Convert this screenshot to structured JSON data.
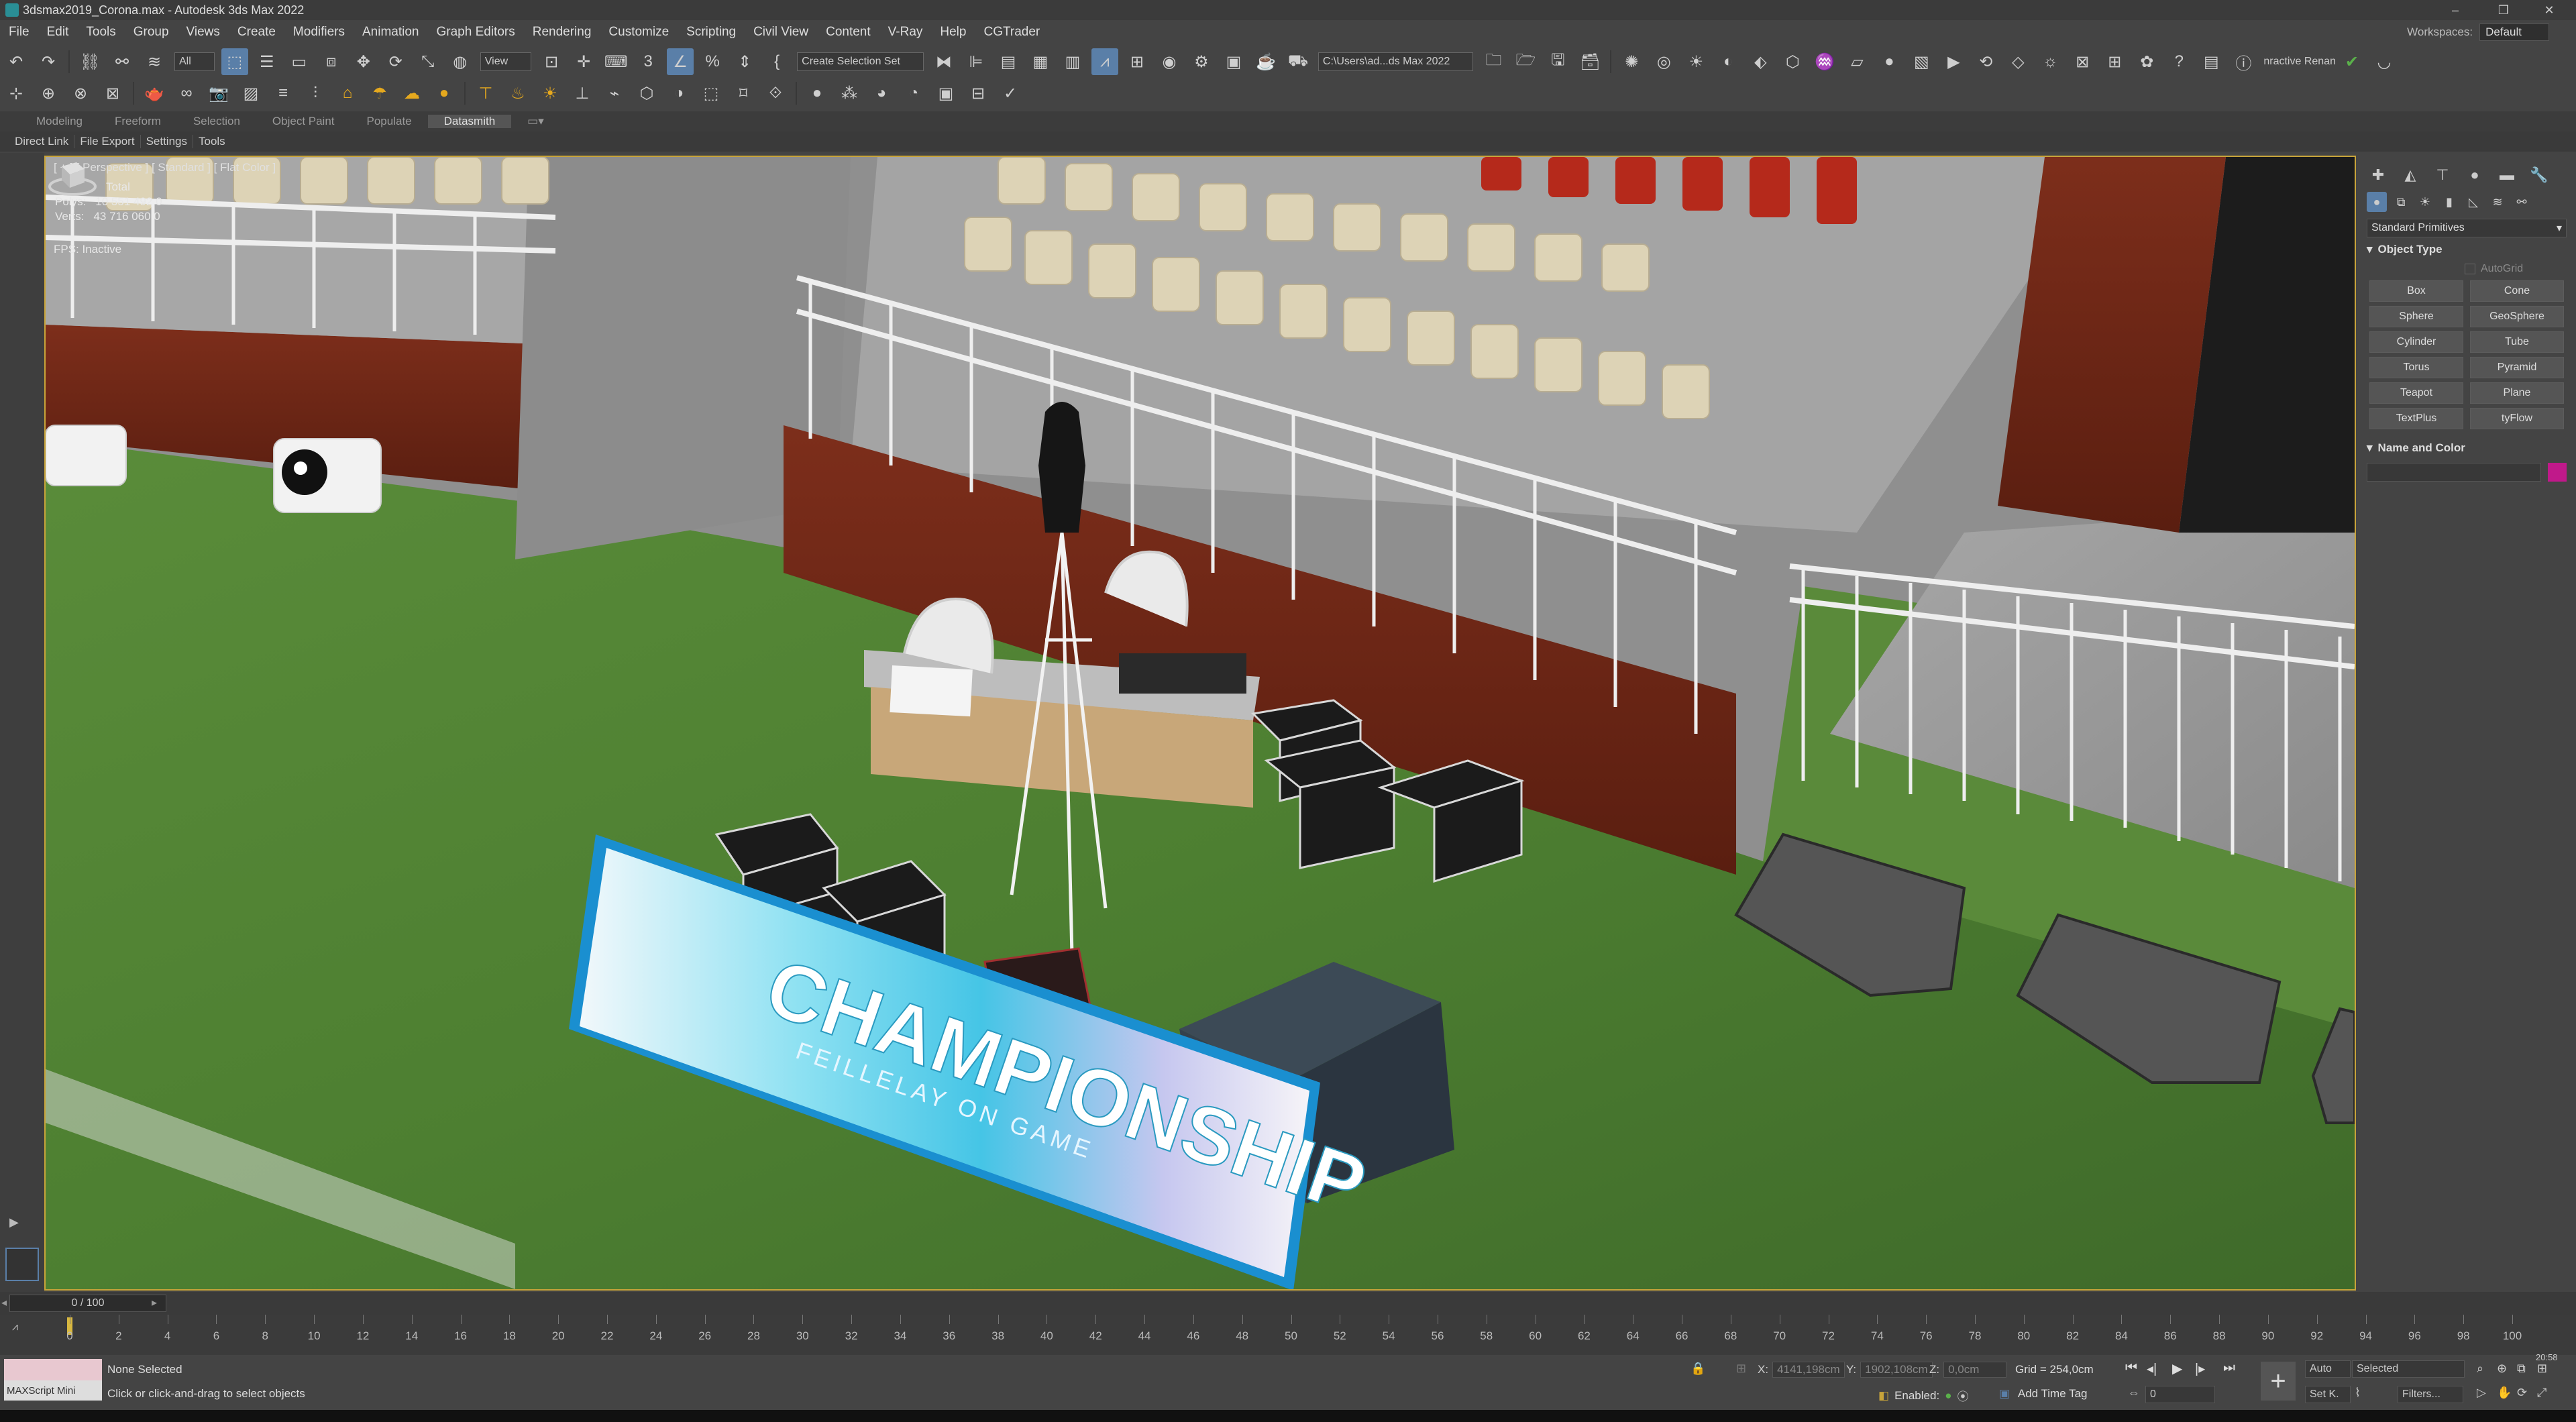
{
  "window": {
    "title": "3dsmax2019_Corona.max - Autodesk 3ds Max 2022"
  },
  "menu": [
    "File",
    "Edit",
    "Tools",
    "Group",
    "Views",
    "Create",
    "Modifiers",
    "Animation",
    "Graph Editors",
    "Rendering",
    "Customize",
    "Scripting",
    "Civil View",
    "Content",
    "V-Ray",
    "Help",
    "CGTrader"
  ],
  "workspaces": {
    "label": "Workspaces:",
    "value": "Default"
  },
  "toolbar": {
    "selection_filter": "All",
    "ref_coord": "View",
    "named_selection": "Create Selection Set",
    "project_path": "C:\\Users\\ad...ds Max 2022",
    "user_label": "nractive Renan"
  },
  "ribbon": {
    "tabs": [
      "Modeling",
      "Freeform",
      "Selection",
      "Object Paint",
      "Populate",
      "Datasmith"
    ],
    "active": "Datasmith"
  },
  "subbar": [
    "Direct Link",
    "File Export",
    "Settings",
    "Tools"
  ],
  "viewport": {
    "label": "[ + ] [ Perspective ] [ Standard ] [ Flat Color ]",
    "stats_total": "Total",
    "polys_label": "Polys:",
    "polys_value": "10 551 492 0",
    "verts_label": "Verts:",
    "verts_value": "43 716 060 0",
    "fps": "FPS:   Inactive",
    "banner_title": "CHAMPIONSHIP",
    "banner_sub": "FEILLELAY ON GAME"
  },
  "command_panel": {
    "category": "Standard Primitives",
    "object_type_title": "Object Type",
    "autogrid": "AutoGrid",
    "buttons": [
      "Box",
      "Cone",
      "Sphere",
      "GeoSphere",
      "Cylinder",
      "Tube",
      "Torus",
      "Pyramid",
      "Teapot",
      "Plane",
      "TextPlus",
      "tyFlow"
    ],
    "name_color_title": "Name and Color",
    "color": "#c0198a"
  },
  "timeline": {
    "frame": "0 / 100",
    "ticks": [
      "0",
      "2",
      "4",
      "6",
      "8",
      "10",
      "12",
      "14",
      "16",
      "18",
      "20",
      "22",
      "24",
      "26",
      "28",
      "30",
      "32",
      "34",
      "36",
      "38",
      "40",
      "42",
      "44",
      "46",
      "48",
      "50",
      "52",
      "54",
      "56",
      "58",
      "60",
      "62",
      "64",
      "66",
      "68",
      "70",
      "72",
      "74",
      "76",
      "78",
      "80",
      "82",
      "84",
      "86",
      "88",
      "90",
      "92",
      "94",
      "96",
      "98",
      "100"
    ]
  },
  "status": {
    "maxscript": "MAXScript Mini",
    "selection": "None Selected",
    "prompt": "Click or click-and-drag to select objects",
    "x_label": "X:",
    "x_value": "4141,198cm",
    "y_label": "Y:",
    "y_value": "1902,108cm",
    "z_label": "Z:",
    "z_value": "0,0cm",
    "grid": "Grid = 254,0cm",
    "enabled": "Enabled:",
    "add_time_tag": "Add Time Tag",
    "auto": "Auto",
    "set_key": "Set K.",
    "key_filter": "Selected",
    "filters": "Filters...",
    "frame_value": "0",
    "clock": "20:58"
  }
}
